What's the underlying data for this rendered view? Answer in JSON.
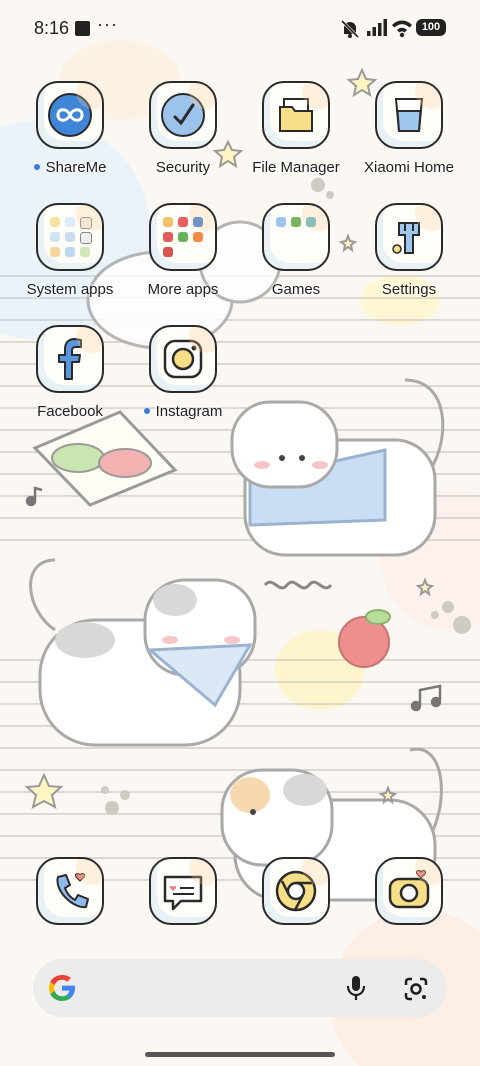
{
  "status_bar": {
    "time": "8:16",
    "notification_square": "stop-square-icon",
    "more_indicator": "···",
    "icons": [
      "mute-icon",
      "signal-icon",
      "wifi-icon"
    ],
    "battery": "100"
  },
  "home": {
    "apps": [
      {
        "id": "shareme",
        "label": "ShareMe",
        "new_dot": true,
        "icon": "infinity-icon"
      },
      {
        "id": "security",
        "label": "Security",
        "new_dot": false,
        "icon": "security-check-icon"
      },
      {
        "id": "file-manager",
        "label": "File Manager",
        "new_dot": false,
        "icon": "folder-icon"
      },
      {
        "id": "xiaomi-home",
        "label": "Xiaomi Home",
        "new_dot": false,
        "icon": "home-glass-icon"
      },
      {
        "id": "system-apps",
        "label": "System apps",
        "new_dot": false,
        "icon": "folder-grid-icon"
      },
      {
        "id": "more-apps",
        "label": "More apps",
        "new_dot": false,
        "icon": "folder-grid-icon"
      },
      {
        "id": "games",
        "label": "Games",
        "new_dot": false,
        "icon": "folder-grid-icon"
      },
      {
        "id": "settings",
        "label": "Settings",
        "new_dot": false,
        "icon": "settings-tools-icon"
      },
      {
        "id": "facebook",
        "label": "Facebook",
        "new_dot": false,
        "icon": "facebook-f-icon"
      },
      {
        "id": "instagram",
        "label": "Instagram",
        "new_dot": true,
        "icon": "instagram-icon"
      }
    ]
  },
  "dock": [
    {
      "id": "phone",
      "icon": "phone-icon"
    },
    {
      "id": "messages",
      "icon": "messages-icon"
    },
    {
      "id": "browser",
      "icon": "chrome-icon"
    },
    {
      "id": "camera",
      "icon": "camera-icon"
    }
  ],
  "search_widget": {
    "logo": "google-g-icon",
    "mic": "mic-icon",
    "lens": "lens-icon"
  },
  "colors": {
    "accent_dot": "#3b7ddd",
    "wallpaper": "#fbf8f3",
    "icon_border": "#2a2a2a"
  }
}
